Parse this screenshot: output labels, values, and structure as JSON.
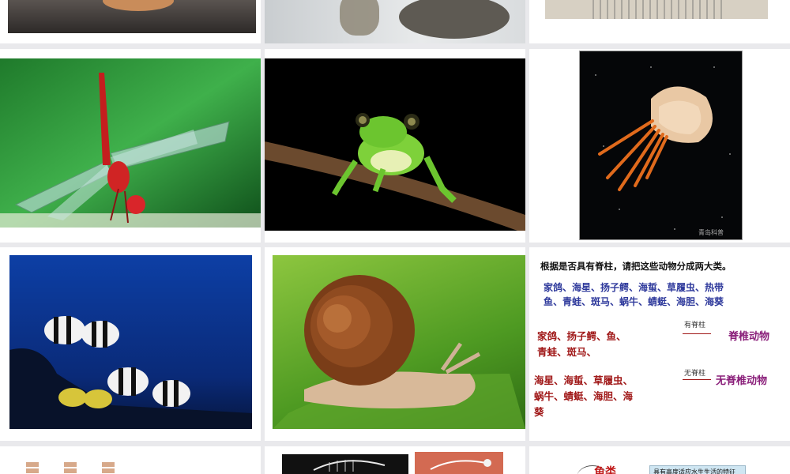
{
  "slides": {
    "classify": {
      "question": "根据是否具有脊柱，请把这些动物分成两大类。",
      "animal_line1": "家鸽、海星、扬子鳄、海蜇、草履虫、热带",
      "animal_line2": "鱼、青蛙、斑马、蜗牛、蜻蜓、海胆、海葵",
      "vert_line1": "家鸽、扬子鳄、鱼、",
      "vert_line2": "青蛙、斑马、",
      "vert_arrow_label": "有脊柱",
      "vert_result": "脊椎动物",
      "invert_line1": "海星、海蜇、草履虫、",
      "invert_line2": "蜗牛、蜻蜓、海胆、海",
      "invert_line3": "葵",
      "invert_arrow_label": "无脊柱",
      "invert_result": "无脊椎动物"
    },
    "watermark": "青岛科普",
    "bottom_right_title": "鱼类",
    "bottom_right_box": "具有高度适应水生生活的特征"
  },
  "colors": {
    "question_text": "#111111",
    "animal_list_text": "#2f3a9c",
    "group_text": "#a01818",
    "result_text": "#8a1f7a"
  }
}
